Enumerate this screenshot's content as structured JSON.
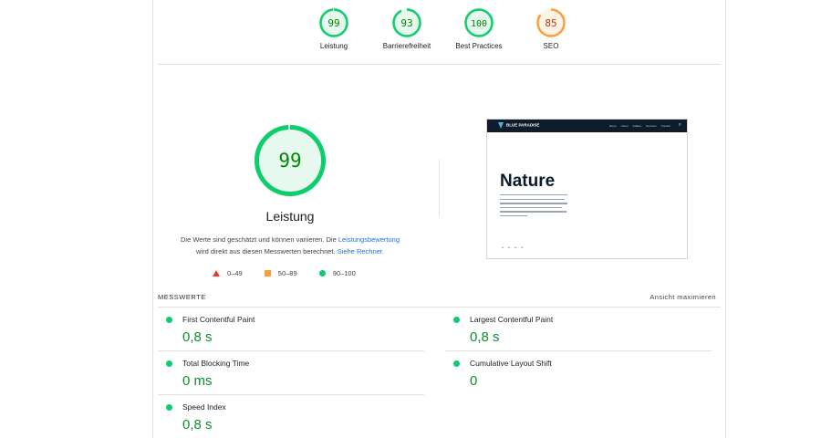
{
  "colors": {
    "pass": "#0cce6b",
    "pass_text": "#008800",
    "average": "#fa9e3b",
    "average_text": "#c33300",
    "fail": "#e53935",
    "link": "#1a73e8"
  },
  "gauges": [
    {
      "score": "99",
      "label": "Leistung",
      "color": "#0cce6b",
      "text_color": "#008800",
      "fraction": 0.99
    },
    {
      "score": "93",
      "label": "Barrierefreiheit",
      "color": "#0cce6b",
      "text_color": "#008800",
      "fraction": 0.93
    },
    {
      "score": "100",
      "label": "Best Practices",
      "color": "#0cce6b",
      "text_color": "#008800",
      "fraction": 1.0
    },
    {
      "score": "85",
      "label": "SEO",
      "color": "#fa9e3b",
      "text_color": "#c33300",
      "fraction": 0.85
    }
  ],
  "main": {
    "score": "99",
    "fraction": 0.99,
    "title": "Leistung",
    "desc_part1": "Die Werte sind geschätzt und können variieren. Die ",
    "desc_link1": "Leistungsbewertung",
    "desc_part2": "wird direkt aus diesen Messwerten berechnet. ",
    "desc_link2": "Siehe Rechner."
  },
  "legend": {
    "fail": "0–49",
    "average": "50–89",
    "pass": "90–100"
  },
  "screenshot": {
    "brand": "BLUE PARADISE",
    "menu": [
      "Home",
      "About",
      "Gallery",
      "Services",
      "Contact"
    ],
    "heading": "Nature",
    "dots": "• • • •"
  },
  "metrics": {
    "header": "MESSWERTE",
    "toggle": "Ansicht maximieren",
    "items": [
      {
        "name": "First Contentful Paint",
        "value": "0,8 s"
      },
      {
        "name": "Largest Contentful Paint",
        "value": "0,8 s"
      },
      {
        "name": "Total Blocking Time",
        "value": "0 ms"
      },
      {
        "name": "Cumulative Layout Shift",
        "value": "0"
      },
      {
        "name": "Speed Index",
        "value": "0,8 s"
      }
    ]
  }
}
